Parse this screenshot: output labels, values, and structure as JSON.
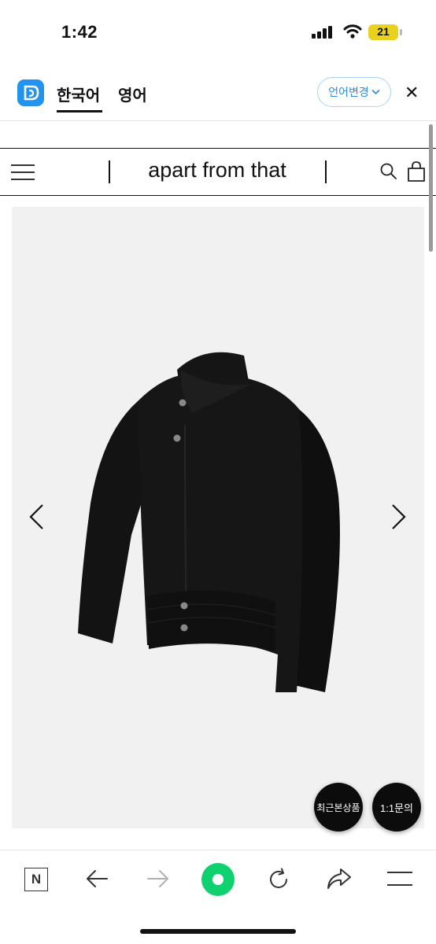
{
  "status_bar": {
    "time": "1:42",
    "battery_level": "21"
  },
  "translate_bar": {
    "tabs": [
      {
        "label": "한국어",
        "active": true
      },
      {
        "label": "영어",
        "active": false
      }
    ],
    "change_language_label": "언어변경",
    "close_symbol": "✕"
  },
  "site_header": {
    "title": "apart from that"
  },
  "floating_buttons": {
    "recent_label": "최근본상품",
    "inquiry_label": "1:1문의"
  },
  "bottom_toolbar": {
    "naver_letter": "N"
  },
  "icons": [
    "signal-icon",
    "wifi-icon",
    "battery-icon",
    "app-logo-icon",
    "chevron-down-icon",
    "close-icon",
    "hamburger-menu-icon",
    "search-icon",
    "shopping-bag-icon",
    "chevron-left-icon",
    "chevron-right-icon",
    "back-arrow-icon",
    "forward-arrow-icon",
    "home-dot-icon",
    "reload-icon",
    "share-icon",
    "menu-icon"
  ],
  "colors": {
    "accent_blue": "#2393f0",
    "battery_yellow": "#e9d21e",
    "green_button": "#0fd16f",
    "floating_button_bg": "#0c0c0c",
    "product_bg": "#f1f1f1"
  }
}
